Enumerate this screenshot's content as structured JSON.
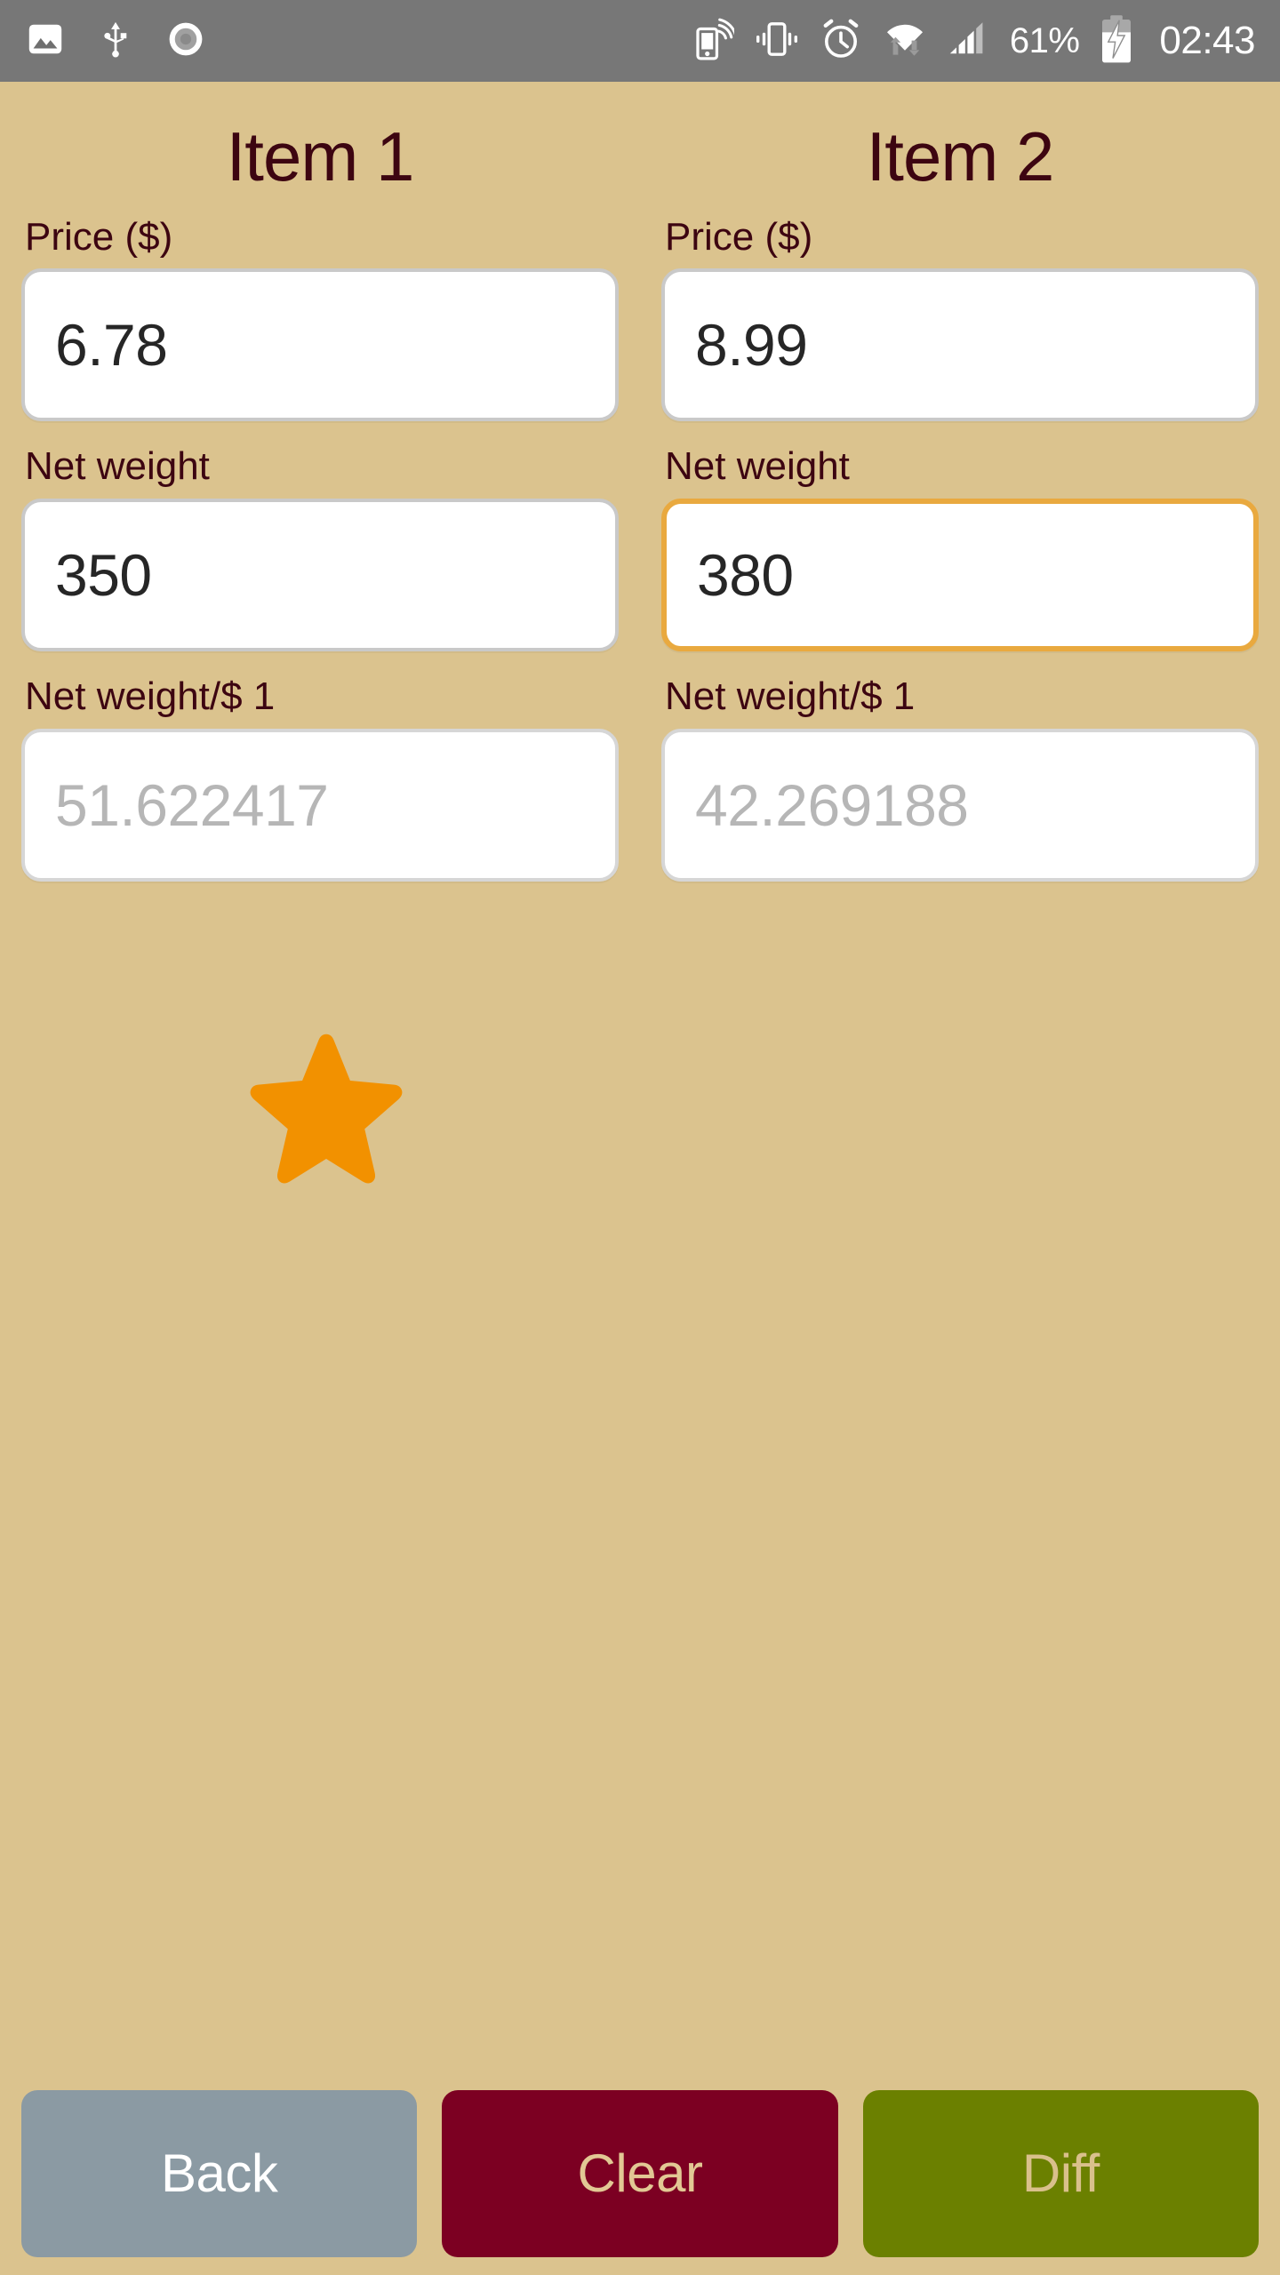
{
  "status_bar": {
    "background_color": "#777777",
    "left_icons": [
      {
        "name": "screenshot-image-icon",
        "label": "Screenshot captured"
      },
      {
        "name": "usb-icon",
        "label": "USB connected"
      },
      {
        "name": "record-icon",
        "label": "Screen recording"
      }
    ],
    "right_icons": [
      {
        "name": "hotspot-icon",
        "label": "Portable hotspot"
      },
      {
        "name": "vibrate-icon",
        "label": "Vibrate mode"
      },
      {
        "name": "alarm-clock-icon",
        "label": "Alarm set"
      },
      {
        "name": "wifi-data-icon",
        "label": "Wi-Fi with data transfer"
      },
      {
        "name": "cellular-signal-icon",
        "label": "Cellular signal"
      }
    ],
    "battery_percent": "61%",
    "battery_charging": true,
    "time": "02:43"
  },
  "theme": {
    "background": "#dbc38e",
    "label_color": "#3d0511",
    "input_border": "#c9c9c9",
    "focus_border": "#e9a93f",
    "star_color": "#f29100",
    "muted_text": "#b6b6b6"
  },
  "columns": [
    {
      "title": "Item 1",
      "fields": [
        {
          "label": "Price ($)",
          "value": "6.78",
          "state": "editable",
          "focused": false
        },
        {
          "label": "Net weight",
          "value": "350",
          "state": "editable",
          "focused": false
        },
        {
          "label": "Net weight/$ 1",
          "value": "51.622417",
          "state": "readonly",
          "focused": false
        }
      ],
      "has_star": true
    },
    {
      "title": "Item 2",
      "fields": [
        {
          "label": "Price ($)",
          "value": "8.99",
          "state": "editable",
          "focused": false
        },
        {
          "label": "Net weight",
          "value": "380",
          "state": "editable",
          "focused": true
        },
        {
          "label": "Net weight/$ 1",
          "value": "42.269188",
          "state": "readonly",
          "focused": false
        }
      ],
      "has_star": false
    }
  ],
  "star": {
    "icon": "star-icon",
    "color": "#f29100",
    "meaning": "best value indicator"
  },
  "buttons": [
    {
      "label": "Back",
      "name": "back-button",
      "bg": "#8b9aa3",
      "fg": "#ffffff"
    },
    {
      "label": "Clear",
      "name": "clear-button",
      "bg": "#7c0022",
      "fg": "#e2c894"
    },
    {
      "label": "Diff",
      "name": "diff-button",
      "bg": "#6b8000",
      "fg": "#d9c08c"
    }
  ]
}
